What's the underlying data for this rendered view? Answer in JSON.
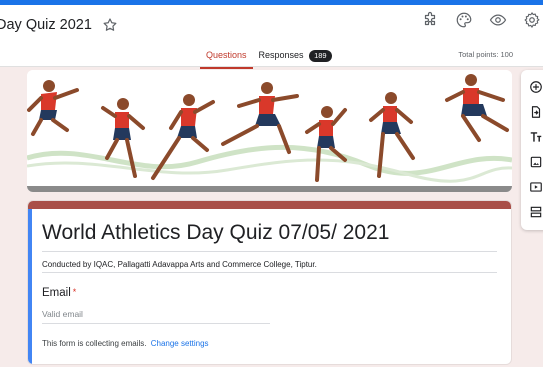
{
  "header": {
    "doc_title": "Day Quiz 2021",
    "icons": [
      "star-icon",
      "addon-icon",
      "palette-icon",
      "preview-icon",
      "settings-icon"
    ]
  },
  "tabs": [
    {
      "label": "Questions",
      "active": true
    },
    {
      "label": "Responses",
      "badge": "189",
      "active": false
    }
  ],
  "total_points": "Total points: 100",
  "form": {
    "title": "World Athletics Day Quiz  07/05/ 2021",
    "description": "Conducted by IQAC, Pallagatti Adavappa Arts and Commerce College, Tiptur.",
    "email_label": "Email",
    "required_mark": "*",
    "email_placeholder": "Valid email",
    "collecting_text": "This form is collecting emails.",
    "change_link": "Change settings"
  },
  "side_toolbar": [
    "add-question-icon",
    "import-questions-icon",
    "add-title-icon",
    "add-image-icon",
    "add-video-icon",
    "add-section-icon"
  ],
  "colors": {
    "accent": "#1a73e8",
    "theme": "#a94f48",
    "active_tab": "#c0392b",
    "background": "#f6ebea"
  }
}
